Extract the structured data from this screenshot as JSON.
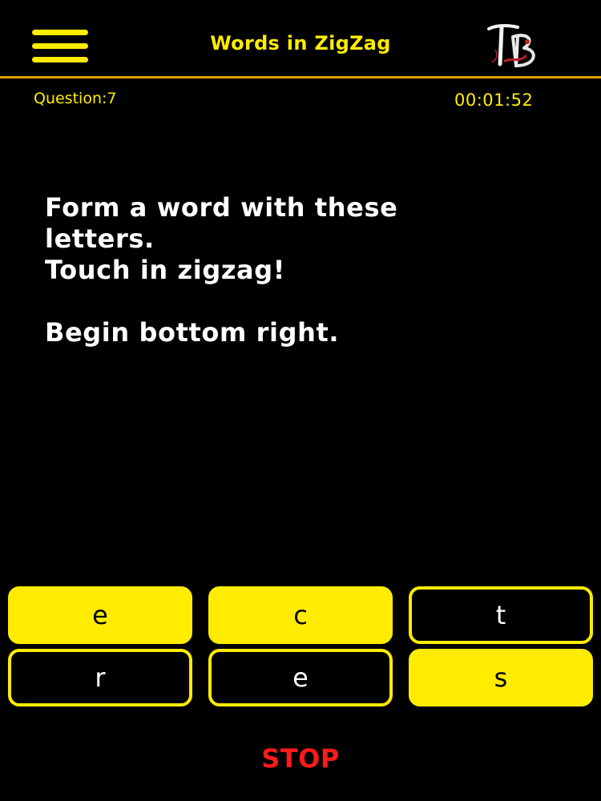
{
  "header": {
    "title": "Words in ZigZag",
    "menu_icon": "hamburger-menu-icon",
    "logo_text": "TB"
  },
  "status": {
    "question": "Question:7",
    "timer": "00:01:52"
  },
  "instructions": {
    "line1": "Form a word with these",
    "line2": "letters.",
    "line3": "Touch in zigzag!",
    "line4": "Begin bottom right."
  },
  "tiles": [
    {
      "letter": "e",
      "selected": true
    },
    {
      "letter": "c",
      "selected": true
    },
    {
      "letter": "t",
      "selected": false
    },
    {
      "letter": "r",
      "selected": false
    },
    {
      "letter": "e",
      "selected": false
    },
    {
      "letter": "s",
      "selected": true
    }
  ],
  "stop_label": "STOP",
  "colors": {
    "background": "#000000",
    "accent": "#ffec00",
    "divider": "#e0a000",
    "stop": "#ff1a1a",
    "text": "#ffffff"
  }
}
